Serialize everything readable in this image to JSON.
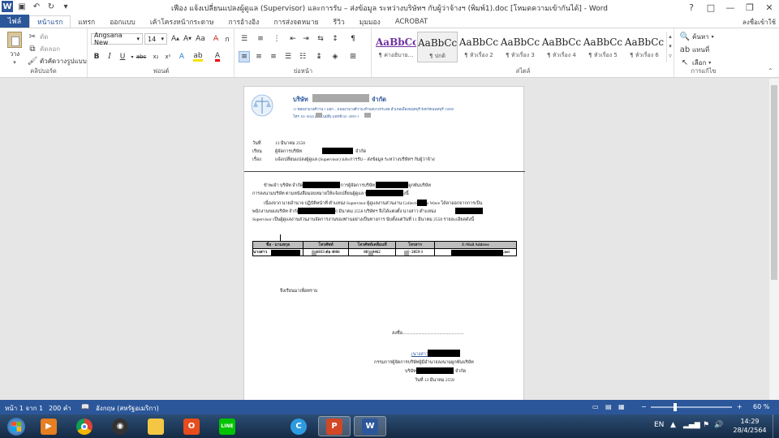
{
  "titlebar": {
    "title": "เฟือง แจ้งเปลี่ยนแปลงผู้ดูแล (Supervisor) และการรับ – ส่งข้อมูล ระหว่างบริษัทฯ กับผู้ว่าจ้างฯ (พิมพ์1).doc [โหมดความเข้ากันได้] - Word",
    "help": "?",
    "ribbon_toggle": "□",
    "minimize": "—",
    "restore": "❐",
    "close": "✕"
  },
  "tabs": [
    "ไฟล์",
    "หน้าแรก",
    "แทรก",
    "ออกแบบ",
    "เค้าโครงหน้ากระดาษ",
    "การอ้างอิง",
    "การส่งจดหมาย",
    "รีวิว",
    "มุมมอง",
    "ACROBAT"
  ],
  "active_tab": "หน้าแรก",
  "signin": "ลงชื่อเข้าใช้",
  "clipboard": {
    "paste": "วาง",
    "cut": "ตัด",
    "copy": "คัดลอก",
    "format_painter": "ตัวคัดวางรูปแบบ",
    "label": "คลิปบอร์ด"
  },
  "font": {
    "family": "Angsana New",
    "size": "14",
    "label": "ฟอนต์"
  },
  "paragraph": {
    "label": "ย่อหน้า"
  },
  "styles": {
    "label": "สไตล์",
    "items": [
      {
        "sample": "AaBbCc",
        "name": "¶ ค่าอธิบาย..."
      },
      {
        "sample": "AaBbCcI",
        "name": "¶ ปกติ"
      },
      {
        "sample": "AaBbCc",
        "name": "¶ หัวเรื่อง 2"
      },
      {
        "sample": "AaBbCc",
        "name": "¶ หัวเรื่อง 3"
      },
      {
        "sample": "AaBbCc",
        "name": "¶ หัวเรื่อง 4"
      },
      {
        "sample": "AaBbCc",
        "name": "¶ หัวเรื่อง 5"
      },
      {
        "sample": "AaBbCc",
        "name": "¶ หัวเรื่อง 6"
      }
    ]
  },
  "editing": {
    "find": "ค้นหา",
    "replace": "แทนที่",
    "select": "เลือก",
    "label": "การแก้ไข"
  },
  "document": {
    "company_line": "บริษัท",
    "company_suffix": "จำกัด",
    "address": "11 ซอยงามวงศ์วาน 1 แยก – ถนนงามวงศ์วาน ตำบลบางกระสอ อำเภอเมืองนนทบุรี จังหวัดนนทบุรี 11000",
    "phone": "โทร .02-     6022 (อัตโนมัติ) แฟกซ์ 02-     2059-1",
    "date_label": "วันที่",
    "date_value": "13 มีนาคม 2558",
    "to_label": "เรียน",
    "to_value": "ผู้จัดการบริษัท",
    "to_suffix": "จำกัด",
    "subject_label": "เรื่อง",
    "subject_value": "แจ้งเปลี่ยนแปลงผู้ดูแล (Supervisor) และการรับ – ส่งข้อมูล ระหว่างบริษัทฯ กับผู้ว่าจ้าง",
    "para1": "ข้าพเจ้า บริษัท                 จำกัด โดย นายสาว              กรรมการผู้จัดการบริษัท ผู้มีอำนาจลงนามผูกพันบริษัท",
    "para1b": "การลงนามบริษัท ตามหนังสือมอบหมายให้แจ้งเปลี่ยนผู้ดูแล บริษัท                จำกัด ทราบ ดังนี้",
    "para2": "เนื่องจาก นายอำนาจ ปฏิบัติหน้าที่ ตำแหน่ง Supervisor ผู้ดูแลงานส่วนงาน Collection       Pro Wave ได้ลาออกจากการเป็น",
    "para2b": "พนักงานของบริษัท                จำกัด โดยมีผล ณ วันที่ 16 มีนาคม 2558 บริษัทฯ จึงได้แต่งตั้ง นางสาว          ตำแหน่ง",
    "para2c": "Supervisor เป็นผู้ดูแลงานส่วนงานจัดการงานของท่านอย่างเป็นทางการ นับตั้งแต่วันที่ 11 มีนาคม 2558 รายละเอียดดังนี้",
    "table_headers": [
      "ชื่อ - นามสกุล",
      "โทรศัพท์",
      "โทรศัพท์เคลื่อนที่",
      "โทรสาร",
      "E-Mail Address"
    ],
    "table_row": [
      "นางสาว",
      "0-     6033 ต่อ 4006",
      "081-     9462",
      "0-     2059-1",
      ".net"
    ],
    "closing": "จึงเรียนมาเพื่อทราบ",
    "sign_line": "ลงชื่อ.......................................................",
    "sign_name": "(นางสาว",
    "sign_title": "กรรมการผู้จัดการบริษัทผู้มีอำนาจลงนามผูกพันบริษัท",
    "sign_company": "บริษัท",
    "sign_company_suffix": "จำกัด",
    "sign_date": "วันที่ 13 มีนาคม 2558"
  },
  "statusbar": {
    "page": "หน้า 1 จาก 1",
    "words": "200 คำ",
    "language": "อังกฤษ (สหรัฐอเมริกา)",
    "zoom": "60 %"
  },
  "taskbar": {
    "lang": "EN",
    "time": "14:29",
    "date": "28/4/2564",
    "apps": [
      "windows-media-player",
      "chrome",
      "xbox",
      "file-explorer",
      "office",
      "line",
      "c-app",
      "powerpoint",
      "word"
    ]
  },
  "colors": {
    "word_blue": "#2b579a",
    "taskbar": "#1c3a5e"
  }
}
